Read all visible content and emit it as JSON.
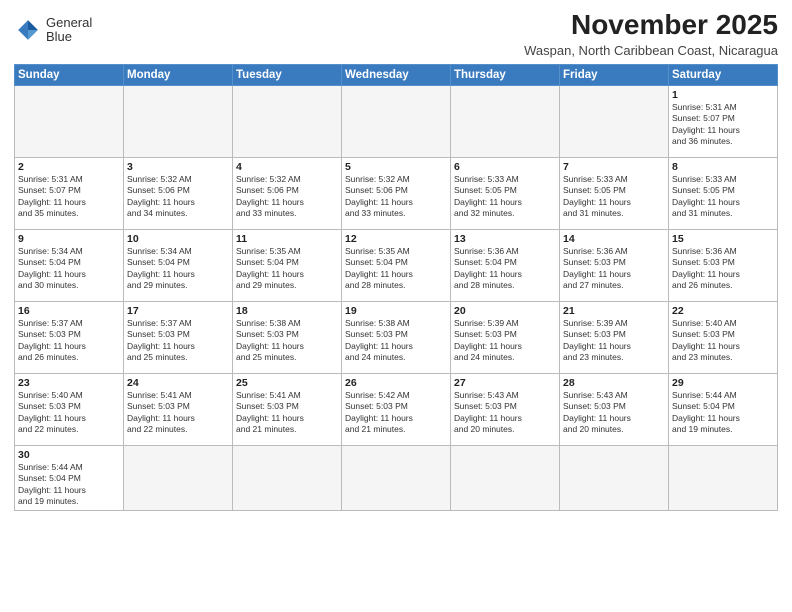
{
  "logo": {
    "line1": "General",
    "line2": "Blue"
  },
  "title": "November 2025",
  "subtitle": "Waspan, North Caribbean Coast, Nicaragua",
  "days_of_week": [
    "Sunday",
    "Monday",
    "Tuesday",
    "Wednesday",
    "Thursday",
    "Friday",
    "Saturday"
  ],
  "weeks": [
    [
      {
        "day": "",
        "info": ""
      },
      {
        "day": "",
        "info": ""
      },
      {
        "day": "",
        "info": ""
      },
      {
        "day": "",
        "info": ""
      },
      {
        "day": "",
        "info": ""
      },
      {
        "day": "",
        "info": ""
      },
      {
        "day": "1",
        "info": "Sunrise: 5:31 AM\nSunset: 5:07 PM\nDaylight: 11 hours\nand 36 minutes."
      }
    ],
    [
      {
        "day": "2",
        "info": "Sunrise: 5:31 AM\nSunset: 5:07 PM\nDaylight: 11 hours\nand 35 minutes."
      },
      {
        "day": "3",
        "info": "Sunrise: 5:32 AM\nSunset: 5:06 PM\nDaylight: 11 hours\nand 34 minutes."
      },
      {
        "day": "4",
        "info": "Sunrise: 5:32 AM\nSunset: 5:06 PM\nDaylight: 11 hours\nand 33 minutes."
      },
      {
        "day": "5",
        "info": "Sunrise: 5:32 AM\nSunset: 5:06 PM\nDaylight: 11 hours\nand 33 minutes."
      },
      {
        "day": "6",
        "info": "Sunrise: 5:33 AM\nSunset: 5:05 PM\nDaylight: 11 hours\nand 32 minutes."
      },
      {
        "day": "7",
        "info": "Sunrise: 5:33 AM\nSunset: 5:05 PM\nDaylight: 11 hours\nand 31 minutes."
      },
      {
        "day": "8",
        "info": "Sunrise: 5:33 AM\nSunset: 5:05 PM\nDaylight: 11 hours\nand 31 minutes."
      }
    ],
    [
      {
        "day": "9",
        "info": "Sunrise: 5:34 AM\nSunset: 5:04 PM\nDaylight: 11 hours\nand 30 minutes."
      },
      {
        "day": "10",
        "info": "Sunrise: 5:34 AM\nSunset: 5:04 PM\nDaylight: 11 hours\nand 29 minutes."
      },
      {
        "day": "11",
        "info": "Sunrise: 5:35 AM\nSunset: 5:04 PM\nDaylight: 11 hours\nand 29 minutes."
      },
      {
        "day": "12",
        "info": "Sunrise: 5:35 AM\nSunset: 5:04 PM\nDaylight: 11 hours\nand 28 minutes."
      },
      {
        "day": "13",
        "info": "Sunrise: 5:36 AM\nSunset: 5:04 PM\nDaylight: 11 hours\nand 28 minutes."
      },
      {
        "day": "14",
        "info": "Sunrise: 5:36 AM\nSunset: 5:03 PM\nDaylight: 11 hours\nand 27 minutes."
      },
      {
        "day": "15",
        "info": "Sunrise: 5:36 AM\nSunset: 5:03 PM\nDaylight: 11 hours\nand 26 minutes."
      }
    ],
    [
      {
        "day": "16",
        "info": "Sunrise: 5:37 AM\nSunset: 5:03 PM\nDaylight: 11 hours\nand 26 minutes."
      },
      {
        "day": "17",
        "info": "Sunrise: 5:37 AM\nSunset: 5:03 PM\nDaylight: 11 hours\nand 25 minutes."
      },
      {
        "day": "18",
        "info": "Sunrise: 5:38 AM\nSunset: 5:03 PM\nDaylight: 11 hours\nand 25 minutes."
      },
      {
        "day": "19",
        "info": "Sunrise: 5:38 AM\nSunset: 5:03 PM\nDaylight: 11 hours\nand 24 minutes."
      },
      {
        "day": "20",
        "info": "Sunrise: 5:39 AM\nSunset: 5:03 PM\nDaylight: 11 hours\nand 24 minutes."
      },
      {
        "day": "21",
        "info": "Sunrise: 5:39 AM\nSunset: 5:03 PM\nDaylight: 11 hours\nand 23 minutes."
      },
      {
        "day": "22",
        "info": "Sunrise: 5:40 AM\nSunset: 5:03 PM\nDaylight: 11 hours\nand 23 minutes."
      }
    ],
    [
      {
        "day": "23",
        "info": "Sunrise: 5:40 AM\nSunset: 5:03 PM\nDaylight: 11 hours\nand 22 minutes."
      },
      {
        "day": "24",
        "info": "Sunrise: 5:41 AM\nSunset: 5:03 PM\nDaylight: 11 hours\nand 22 minutes."
      },
      {
        "day": "25",
        "info": "Sunrise: 5:41 AM\nSunset: 5:03 PM\nDaylight: 11 hours\nand 21 minutes."
      },
      {
        "day": "26",
        "info": "Sunrise: 5:42 AM\nSunset: 5:03 PM\nDaylight: 11 hours\nand 21 minutes."
      },
      {
        "day": "27",
        "info": "Sunrise: 5:43 AM\nSunset: 5:03 PM\nDaylight: 11 hours\nand 20 minutes."
      },
      {
        "day": "28",
        "info": "Sunrise: 5:43 AM\nSunset: 5:03 PM\nDaylight: 11 hours\nand 20 minutes."
      },
      {
        "day": "29",
        "info": "Sunrise: 5:44 AM\nSunset: 5:04 PM\nDaylight: 11 hours\nand 19 minutes."
      }
    ],
    [
      {
        "day": "30",
        "info": "Sunrise: 5:44 AM\nSunset: 5:04 PM\nDaylight: 11 hours\nand 19 minutes."
      },
      {
        "day": "",
        "info": ""
      },
      {
        "day": "",
        "info": ""
      },
      {
        "day": "",
        "info": ""
      },
      {
        "day": "",
        "info": ""
      },
      {
        "day": "",
        "info": ""
      },
      {
        "day": "",
        "info": ""
      }
    ]
  ]
}
